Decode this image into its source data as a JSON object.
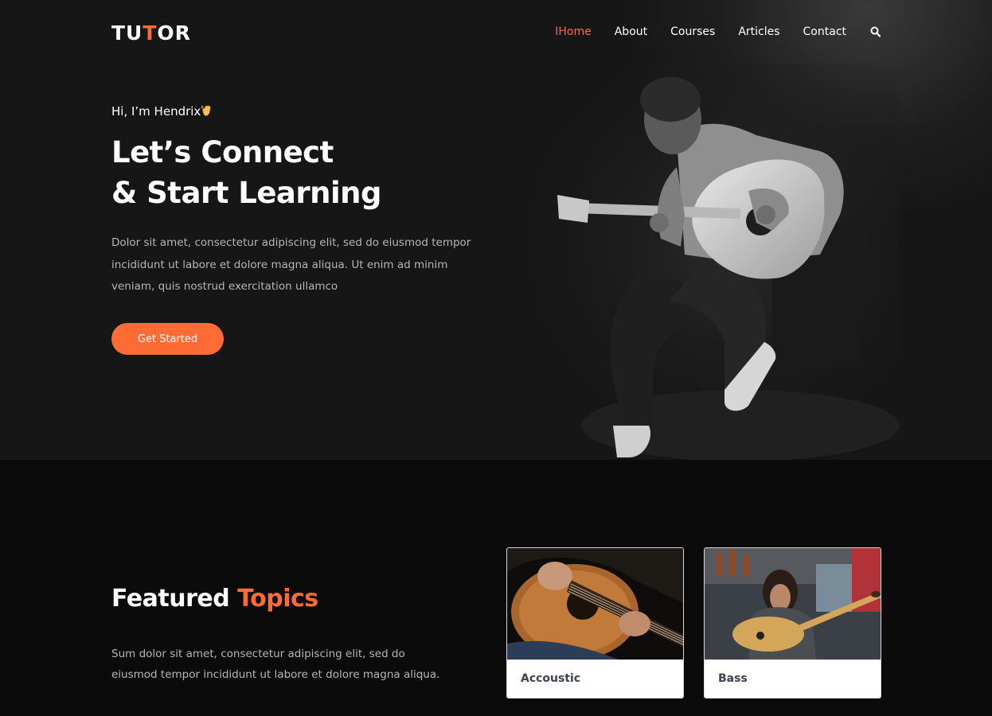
{
  "brand": {
    "logo_prefix": "TU",
    "logo_accent": "T",
    "logo_suffix": "OR",
    "accent_color": "#ff6b35"
  },
  "nav": {
    "items": [
      {
        "label": "IHome",
        "active": true
      },
      {
        "label": "About"
      },
      {
        "label": "Courses"
      },
      {
        "label": "Articles"
      },
      {
        "label": "Contact"
      }
    ],
    "search_icon": "search-icon"
  },
  "hero": {
    "greeting": "Hi, I’m Hendrix",
    "greeting_emoji": "waving-hand-icon",
    "headline_line1": "Let’s Connect",
    "headline_line2": "& Start Learning",
    "description": "Dolor sit amet, consectetur adipiscing elit, sed do eiusmod tempor incididunt ut labore et dolore magna aliqua. Ut enim ad minim veniam, quis nostrud exercitation ullamco",
    "cta_label": "Get Started"
  },
  "featured": {
    "title_main": "Featured",
    "title_accent": "Topics",
    "description": "Sum dolor sit amet, consectetur adipiscing elit, sed do eiusmod tempor incididunt ut labore et dolore magna aliqua.",
    "cards": [
      {
        "label": "Accoustic"
      },
      {
        "label": "Bass"
      }
    ]
  }
}
